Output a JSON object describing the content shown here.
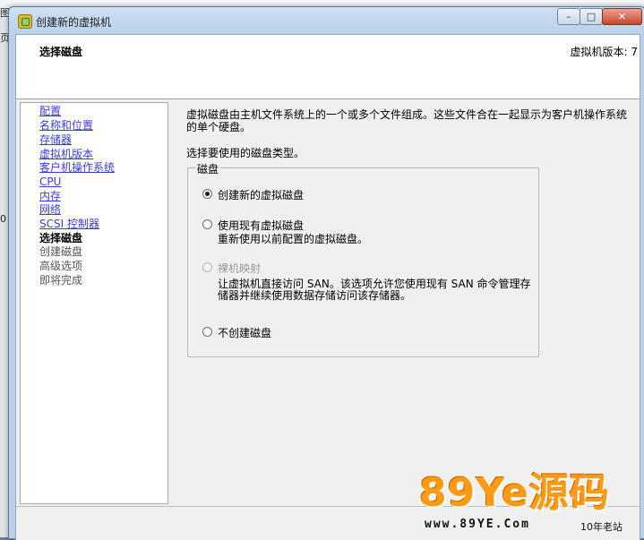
{
  "background": {
    "side_chars": [
      "图",
      "页",
      "0"
    ]
  },
  "window": {
    "title": "创建新的虚拟机",
    "buttons": {
      "minimize": "–",
      "maximize": "□",
      "close": "✕"
    }
  },
  "header": {
    "title": "选择磁盘",
    "version": "虚拟机版本: 7"
  },
  "nav": {
    "items": [
      {
        "label": "配置",
        "state": "link"
      },
      {
        "label": "名称和位置",
        "state": "link"
      },
      {
        "label": "存储器",
        "state": "link"
      },
      {
        "label": "虚拟机版本",
        "state": "link"
      },
      {
        "label": "客户机操作系统",
        "state": "link"
      },
      {
        "label": "CPU",
        "state": "link"
      },
      {
        "label": "内存",
        "state": "link"
      },
      {
        "label": "网络",
        "state": "link"
      },
      {
        "label": "SCSI 控制器",
        "state": "link"
      },
      {
        "label": "选择磁盘",
        "state": "current"
      },
      {
        "label": "创建磁盘",
        "state": "pending"
      },
      {
        "label": "高级选项",
        "state": "pending"
      },
      {
        "label": "即将完成",
        "state": "pending"
      }
    ]
  },
  "content": {
    "description": "虚拟磁盘由主机文件系统上的一个或多个文件组成。这些文件合在一起显示为客户机操作系统的单个硬盘。",
    "prompt": "选择要使用的磁盘类型。",
    "group_label": "磁盘",
    "options": [
      {
        "label": "创建新的虚拟磁盘",
        "checked": true,
        "enabled": true,
        "sub": ""
      },
      {
        "label": "使用现有虚拟磁盘",
        "checked": false,
        "enabled": true,
        "sub": "重新使用以前配置的虚拟磁盘。"
      },
      {
        "label": "裸机映射",
        "checked": false,
        "enabled": false,
        "sub": "让虚拟机直接访问 SAN。该选项允许您使用现有 SAN 命令管理存储器并继续使用数据存储访问该存储器。"
      },
      {
        "label": "不创建磁盘",
        "checked": false,
        "enabled": true,
        "sub": ""
      }
    ]
  },
  "watermark": {
    "main": "89Ye源码",
    "url": "www.89YE.Com",
    "tag": "10年老站"
  }
}
